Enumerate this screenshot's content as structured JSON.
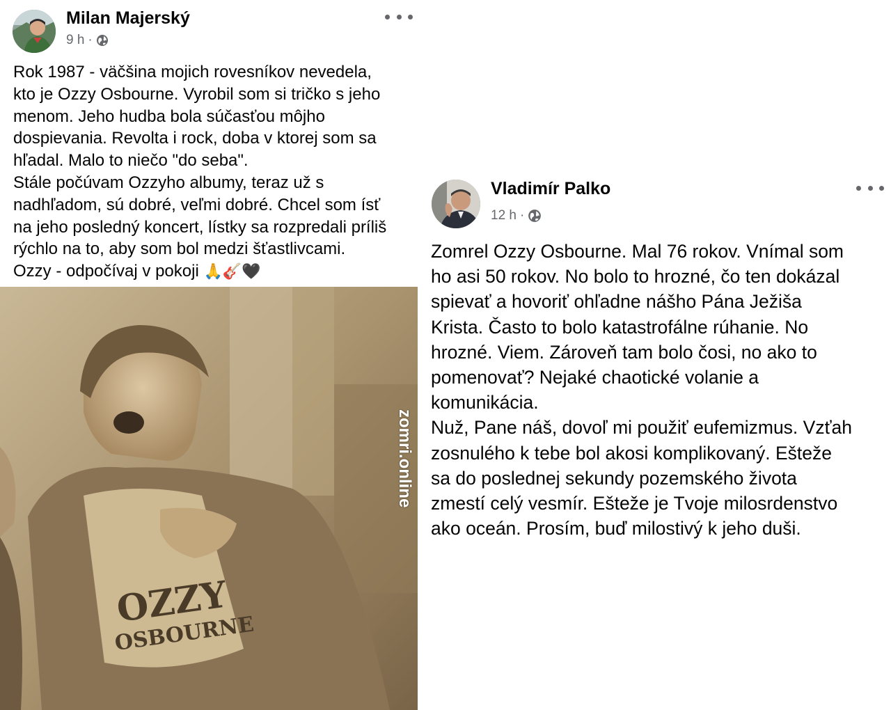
{
  "posts": [
    {
      "author": "Milan Majerský",
      "time": "9 h",
      "separator": "·",
      "privacy_icon": "globe-icon",
      "more_icon": "more-options-icon",
      "text_lines": [
        "Rok 1987 - väčšina mojich rovesníkov nevedela,",
        "kto je Ozzy Osbourne. Vyrobil som si tričko s jeho",
        "menom. Jeho hudba bola súčasťou môjho",
        "dospievania. Revolta i rock, doba v ktorej som sa",
        "hľadal. Malo to niečo \"do seba\".",
        "Stále počúvam Ozzyho albumy, teraz už s",
        "nadhľadom, sú dobré, veľmi dobré. Chcel som ísť",
        "na jeho posledný koncert, lístky sa rozpredali príliš",
        "rýchlo na to, aby som bol medzi šťastlivcami."
      ],
      "last_line": "Ozzy - odpočívaj v pokoji",
      "emojis": [
        "🙏",
        "🎸",
        "🖤"
      ],
      "photo": {
        "shirt_text_1": "OZZY",
        "shirt_text_2": "OSBOURNE",
        "watermark": "zomri.online"
      }
    },
    {
      "author": "Vladimír Palko",
      "time": "12 h",
      "separator": "·",
      "privacy_icon": "globe-icon",
      "more_icon": "more-options-icon",
      "text_lines": [
        "Zomrel Ozzy Osbourne. Mal 76 rokov. Vnímal som",
        "ho asi 50 rokov. No bolo to hrozné, čo ten dokázal",
        "spievať a hovoriť ohľadne nášho Pána Ježiša",
        "Krista. Často to bolo katastrofálne rúhanie. No",
        "hrozné. Viem. Zároveň tam bolo čosi, no ako to",
        "pomenovať? Nejaké chaotické volanie a",
        "komunikácia.",
        "Nuž, Pane náš, dovoľ mi použiť eufemizmus. Vzťah",
        "zosnulého k tebe bol akosi komplikovaný. Ešteže",
        "sa do poslednej sekundy pozemského života",
        "zmestí celý vesmír. Ešteže je Tvoje milosrdenstvo",
        "ako oceán. Prosím, buď milostivý k jeho duši."
      ]
    }
  ],
  "colors": {
    "text": "#050505",
    "meta": "#65676b",
    "photo_sepia": "#a8916d"
  }
}
